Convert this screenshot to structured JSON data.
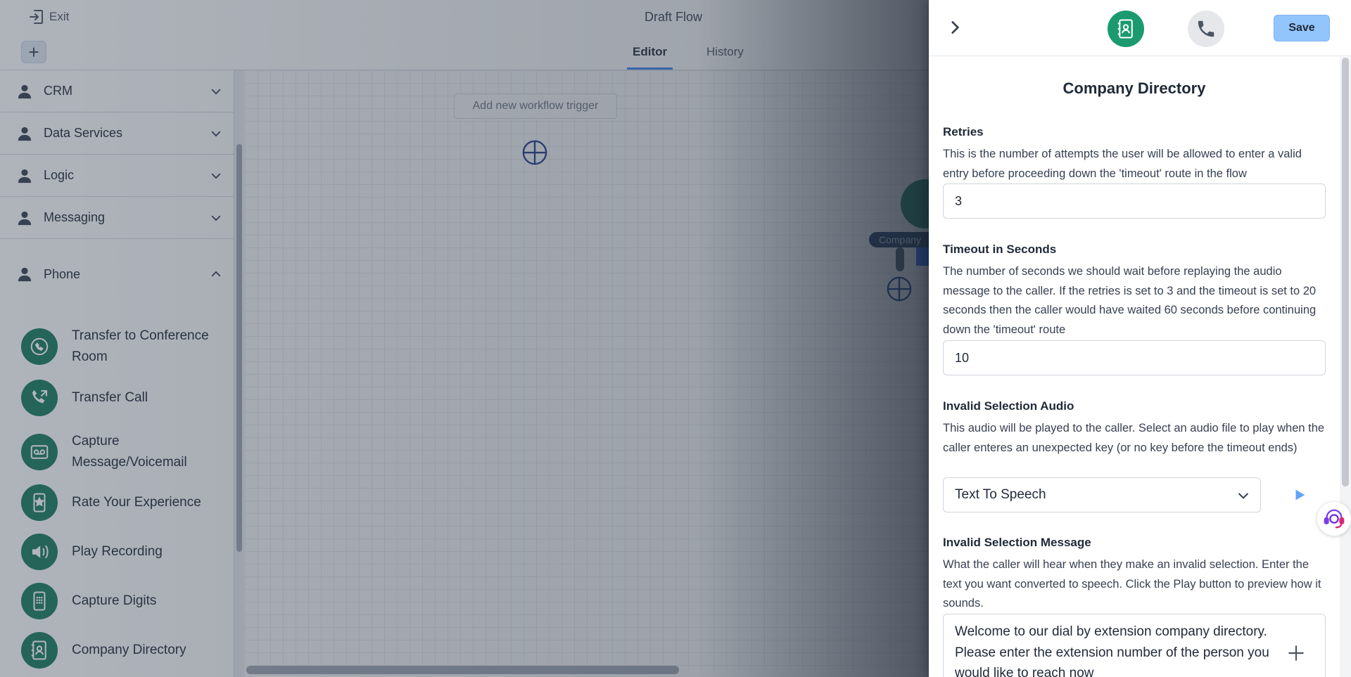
{
  "header": {
    "exit_label": "Exit",
    "flow_title": "Draft Flow",
    "tabs": [
      {
        "label": "Editor",
        "active": true
      },
      {
        "label": "History",
        "active": false
      }
    ]
  },
  "sidebar": {
    "categories": [
      {
        "label": "CRM",
        "icon": "person-icon",
        "expanded": false
      },
      {
        "label": "Data Services",
        "icon": "person-icon",
        "expanded": false
      },
      {
        "label": "Logic",
        "icon": "person-icon",
        "expanded": false
      },
      {
        "label": "Messaging",
        "icon": "person-icon",
        "expanded": false
      },
      {
        "label": "Phone",
        "icon": "person-icon",
        "expanded": true
      }
    ],
    "phone_items": [
      {
        "label": "Transfer to Conference Room",
        "icon": "conference-transfer-icon"
      },
      {
        "label": "Transfer Call",
        "icon": "phone-transfer-icon"
      },
      {
        "label": "Capture Message/Voicemail",
        "icon": "voicemail-icon"
      },
      {
        "label": "Rate Your Experience",
        "icon": "rating-icon"
      },
      {
        "label": "Play Recording",
        "icon": "speaker-icon"
      },
      {
        "label": "Capture Digits",
        "icon": "keypad-icon"
      },
      {
        "label": "Company Directory",
        "icon": "directory-icon"
      }
    ]
  },
  "canvas": {
    "trigger_label": "Add new workflow trigger",
    "node_label": "Company"
  },
  "panel": {
    "save_label": "Save",
    "title": "Company Directory",
    "retries": {
      "label": "Retries",
      "description": "This is the number of attempts the user will be allowed to enter a valid entry before proceeding down the 'timeout' route in the flow",
      "value": "3"
    },
    "timeout": {
      "label": "Timeout in Seconds",
      "description": "The number of seconds we should wait before replaying the audio message to the caller. If the retries is set to 3 and the timeout is set to 20 seconds then the caller would have waited 60 seconds before continuing down the 'timeout' route",
      "value": "10"
    },
    "invalid_audio": {
      "label": "Invalid Selection Audio",
      "description": "This audio will be played to the caller. Select an audio file to play when the caller enteres an unexpected key (or no key before the timeout ends)",
      "selected": "Text To Speech"
    },
    "invalid_message": {
      "label": "Invalid Selection Message",
      "description": "What the caller will hear when they make an invalid selection. Enter the text you want converted to speech. Click the Play button to preview how it sounds.",
      "value": "Welcome to our dial by extension company directory. Please enter the extension number of the person you would like to reach now"
    }
  },
  "colors": {
    "accent": "#3b82f6",
    "save_button": "#93c5fd",
    "node_green": "#1a7a5e",
    "overlay": "#374151"
  }
}
